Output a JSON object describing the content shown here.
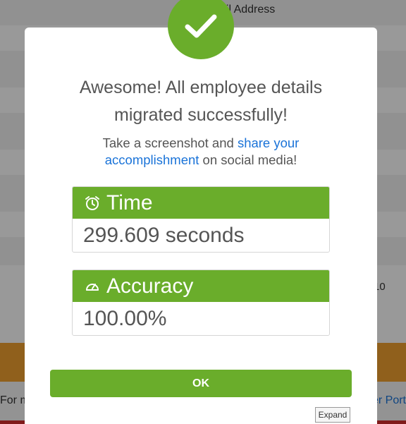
{
  "background": {
    "column_header": "Email Address",
    "column_header_visible": "ail Address",
    "right_cell_value": "10",
    "footer_left_visible": "For m",
    "footer_right_visible": "er Port"
  },
  "modal": {
    "title_line1": "Awesome! All employee details",
    "title_line2": "migrated successfully!",
    "subtitle_prefix": "Take a screenshot and ",
    "subtitle_link_line1": "share your",
    "subtitle_link_line2": "accomplishment",
    "subtitle_suffix": " on social media!",
    "time": {
      "label": "Time",
      "value": "299.609 seconds",
      "icon": "alarm-clock-icon"
    },
    "accuracy": {
      "label": "Accuracy",
      "value": "100.00%",
      "icon": "speedometer-icon"
    },
    "ok_label": "OK"
  },
  "expand_label": "Expand",
  "colors": {
    "accent_green": "#6aad2b",
    "link_blue": "#1a73d8",
    "orange_band": "#f0a030",
    "red_line": "#d62e2e"
  }
}
